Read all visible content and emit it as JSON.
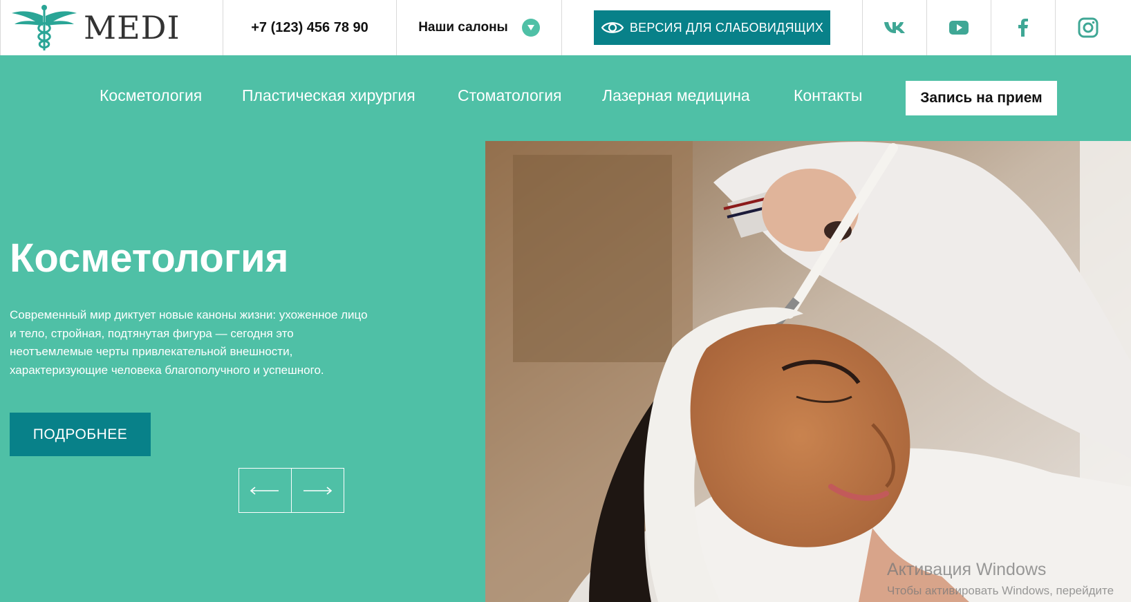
{
  "header": {
    "logo_text": "MEDI",
    "phone": "+7 (123) 456 78 90",
    "salons_label": "Наши салоны",
    "accessibility_label": "ВЕРСИЯ ДЛЯ СЛАБОВИДЯЩИХ",
    "social": [
      {
        "icon": "vk-icon"
      },
      {
        "icon": "youtube-icon"
      },
      {
        "icon": "facebook-icon"
      },
      {
        "icon": "instagram-icon"
      }
    ]
  },
  "nav": {
    "items": [
      "Косметология",
      "Пластическая хирургия",
      "Стоматология",
      "Лазерная медицина",
      "Контакты"
    ],
    "appointment_label": "Запись на прием"
  },
  "hero": {
    "title": "Косметология",
    "text": "Современный мир диктует новые каноны жизни: ухоженное лицо и тело, стройная, подтянутая фигура — сегодня это неотъемлемые черты привлекательной внешности, характеризующие человека благополучного и успешного.",
    "more_label": "ПОДРОБНЕЕ"
  },
  "watermark": {
    "line1": "Активация Windows",
    "line2": "Чтобы активировать Windows, перейдите"
  },
  "colors": {
    "accent": "#4fc0a6",
    "dark_teal": "#088189"
  }
}
